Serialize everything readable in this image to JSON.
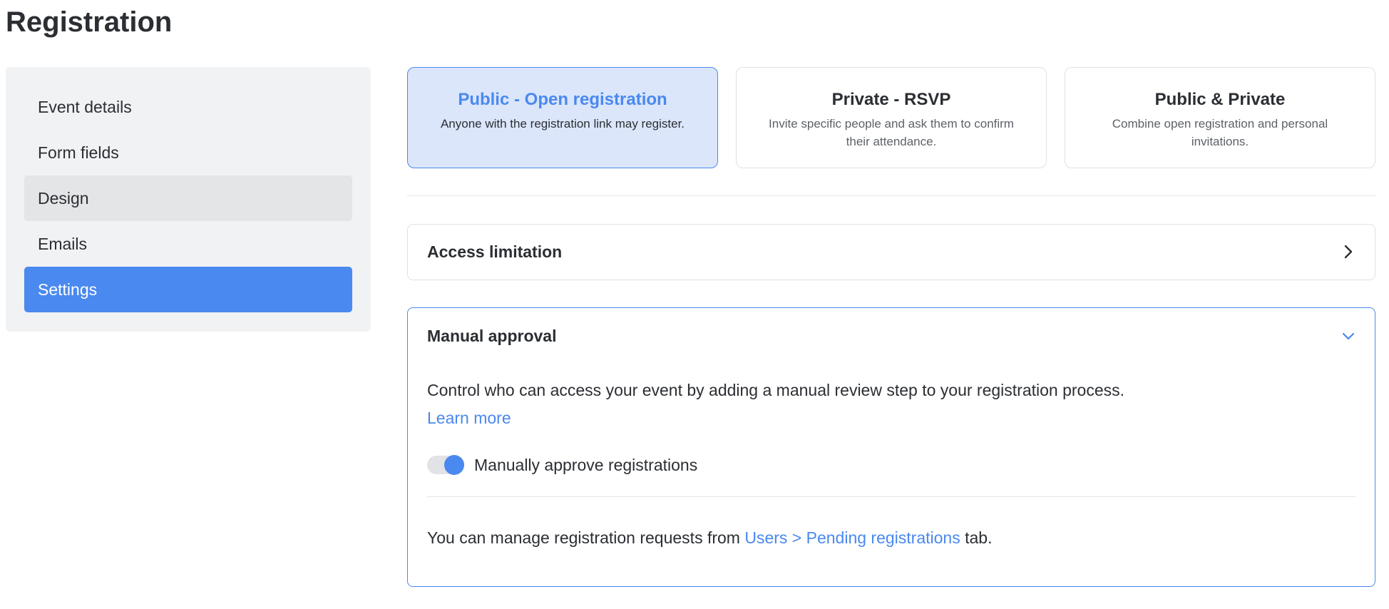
{
  "page": {
    "title": "Registration"
  },
  "sidebar": {
    "items": [
      {
        "label": "Event details",
        "state": "default"
      },
      {
        "label": "Form fields",
        "state": "default"
      },
      {
        "label": "Design",
        "state": "hover"
      },
      {
        "label": "Emails",
        "state": "default"
      },
      {
        "label": "Settings",
        "state": "active"
      }
    ]
  },
  "registration_types": [
    {
      "title": "Public - Open registration",
      "description": "Anyone with the registration link may register.",
      "selected": true
    },
    {
      "title": "Private - RSVP",
      "description": "Invite specific people and ask them to confirm their attendance.",
      "selected": false
    },
    {
      "title": "Public & Private",
      "description": "Combine open registration and personal invitations.",
      "selected": false
    }
  ],
  "access_limitation": {
    "title": "Access limitation",
    "icon": "chevron-right-icon",
    "expanded": false
  },
  "manual_approval": {
    "title": "Manual approval",
    "icon": "chevron-down-icon",
    "expanded": true,
    "description": "Control who can access your event by adding a manual review step to your registration process.",
    "learn_more": "Learn more",
    "toggle_label": "Manually approve registrations",
    "toggle_on": true,
    "footer_prefix": "You can manage registration requests from ",
    "footer_link": "Users > Pending registrations",
    "footer_suffix": " tab."
  },
  "colors": {
    "accent": "#4a89ef",
    "selected_card_bg": "#dbe6fb",
    "sidebar_bg": "#f1f2f4",
    "text": "#2b2e33"
  }
}
